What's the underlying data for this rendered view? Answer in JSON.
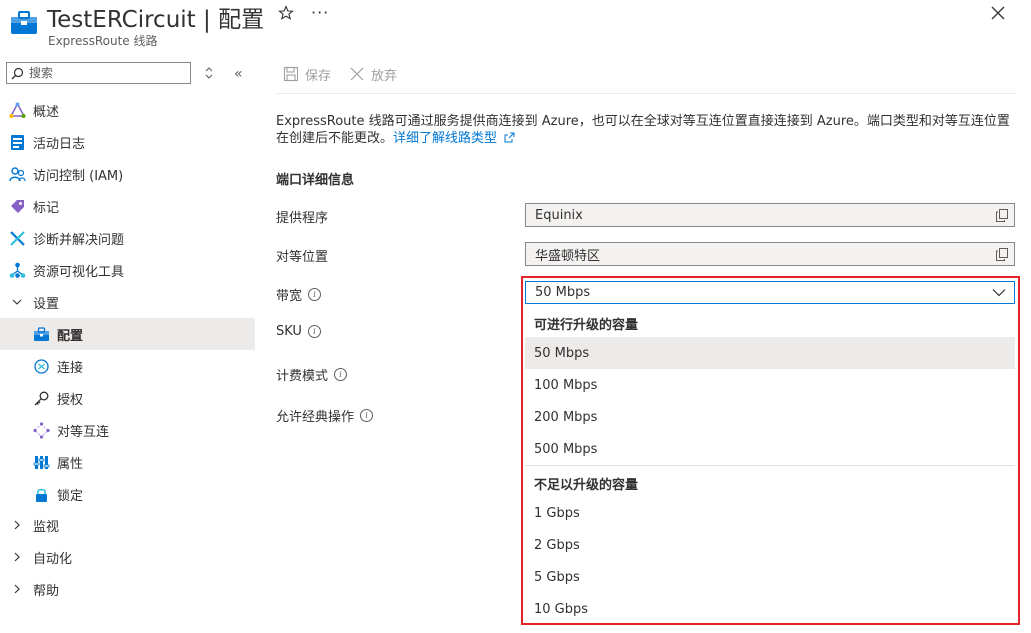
{
  "header": {
    "title": "TestERCircuit | 配置",
    "subtitle": "ExpressRoute 线路",
    "favorite_icon": "star-icon",
    "more_icon": "more-icon",
    "close_icon": "close-icon",
    "more_label": "···"
  },
  "sidebar": {
    "search_placeholder": "搜索",
    "collapse_label": "«",
    "items": [
      {
        "label": "概述",
        "icon": "overview-icon"
      },
      {
        "label": "活动日志",
        "icon": "activity-log-icon"
      },
      {
        "label": "访问控制 (IAM)",
        "icon": "iam-icon"
      },
      {
        "label": "标记",
        "icon": "tag-icon"
      },
      {
        "label": "诊断并解决问题",
        "icon": "diagnose-icon"
      },
      {
        "label": "资源可视化工具",
        "icon": "visualizer-icon"
      },
      {
        "label": "设置",
        "icon": "chevron-down-icon"
      },
      {
        "label": "配置",
        "icon": "configuration-icon"
      },
      {
        "label": "连接",
        "icon": "connection-icon"
      },
      {
        "label": "授权",
        "icon": "key-icon"
      },
      {
        "label": "对等互连",
        "icon": "peering-icon"
      },
      {
        "label": "属性",
        "icon": "properties-icon"
      },
      {
        "label": "锁定",
        "icon": "lock-icon"
      },
      {
        "label": "监视",
        "icon": "chevron-right-icon"
      },
      {
        "label": "自动化",
        "icon": "chevron-right-icon"
      },
      {
        "label": "帮助",
        "icon": "chevron-right-icon"
      }
    ]
  },
  "toolbar": {
    "save_label": "保存",
    "discard_label": "放弃"
  },
  "main": {
    "description": "ExpressRoute 线路可通过服务提供商连接到 Azure，也可以在全球对等互连位置直接连接到 Azure。端口类型和对等互连位置在创建后不能更改。",
    "learn_more_link": "详细了解线路类型",
    "section_title": "端口详细信息",
    "provider_label": "提供程序",
    "provider_value": "Equinix",
    "peering_location_label": "对等位置",
    "peering_location_value": "华盛顿特区",
    "bandwidth_label": "带宽",
    "sku_label": "SKU",
    "billing_label": "计费模式",
    "classic_label": "允许经典操作",
    "info_glyph": "i"
  },
  "bandwidth_dropdown": {
    "selected": "50 Mbps",
    "group_upgradable": "可进行升级的容量",
    "upgradable_options": [
      "50 Mbps",
      "100 Mbps",
      "200 Mbps",
      "500 Mbps"
    ],
    "group_not_upgradable": "不足以升级的容量",
    "not_upgradable_options": [
      "1 Gbps",
      "2 Gbps",
      "5 Gbps",
      "10 Gbps"
    ]
  },
  "colors": {
    "accent": "#0078d4",
    "highlight": "#e3242b",
    "selected_bg": "#edebe9"
  }
}
